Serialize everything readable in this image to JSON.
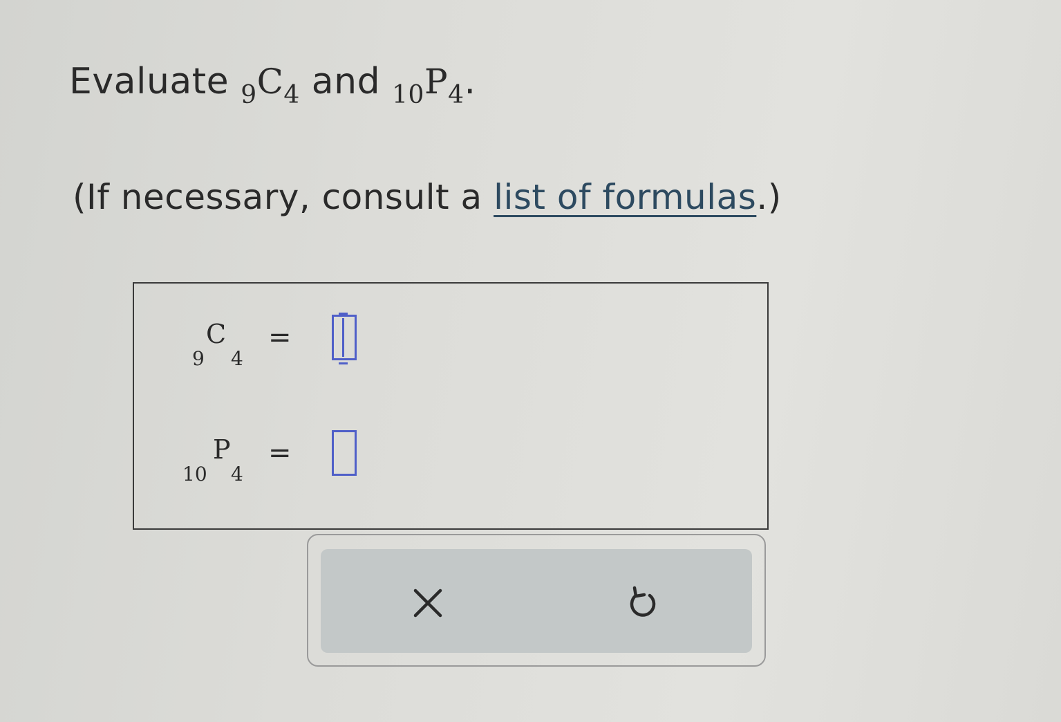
{
  "question": {
    "prefix": "Evaluate ",
    "expr1": {
      "pre": "9",
      "letter": "C",
      "post": "4"
    },
    "conjunction": " and ",
    "expr2": {
      "pre": "10",
      "letter": "P",
      "post": "4"
    },
    "end": "."
  },
  "hint": {
    "before": "(If necessary, consult a ",
    "link": "list of formulas",
    "after": ".)"
  },
  "answers": [
    {
      "pre": "9",
      "letter": "C",
      "post": "4",
      "equals": "=",
      "value": ""
    },
    {
      "pre": "10",
      "letter": "P",
      "post": "4",
      "equals": "=",
      "value": ""
    }
  ],
  "controls": {
    "clear_icon": "close-icon",
    "undo_icon": "undo-icon"
  },
  "colors": {
    "link": "#2d4a60",
    "input_border": "#4f5fc8",
    "panel_border": "#3a3a3a",
    "control_bg": "#c3c8c8"
  }
}
